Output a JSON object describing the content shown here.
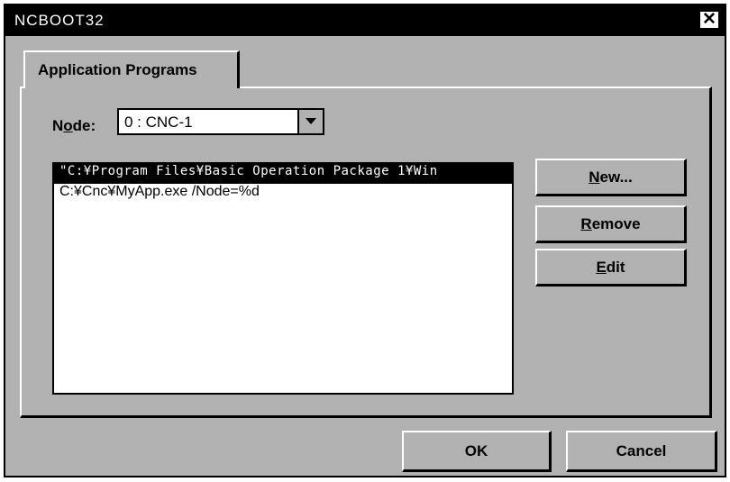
{
  "window": {
    "title": "NCBOOT32",
    "close_icon": "close-icon"
  },
  "tabs": [
    {
      "label": "Application Programs",
      "active": true
    }
  ],
  "node": {
    "label_prefix": "N",
    "label_accel": "o",
    "label_suffix": "de:",
    "selected_value": "0 : CNC-1",
    "dropdown_icon": "chevron-down-icon"
  },
  "programs": {
    "items": [
      {
        "text": "\"C:¥Program Files¥Basic Operation Package 1¥Win",
        "selected": true
      },
      {
        "text": "C:¥Cnc¥MyApp.exe /Node=%d",
        "selected": false
      }
    ]
  },
  "side_buttons": {
    "new": {
      "accel": "N",
      "rest": "ew..."
    },
    "remove": {
      "accel": "R",
      "rest": "emove"
    },
    "edit": {
      "accel": "E",
      "rest": "dit"
    }
  },
  "footer": {
    "ok_label": "OK",
    "cancel_label": "Cancel"
  },
  "colors": {
    "titlebar": "#000000",
    "face_dither": "#cfcfcf",
    "selection": "#000000"
  }
}
